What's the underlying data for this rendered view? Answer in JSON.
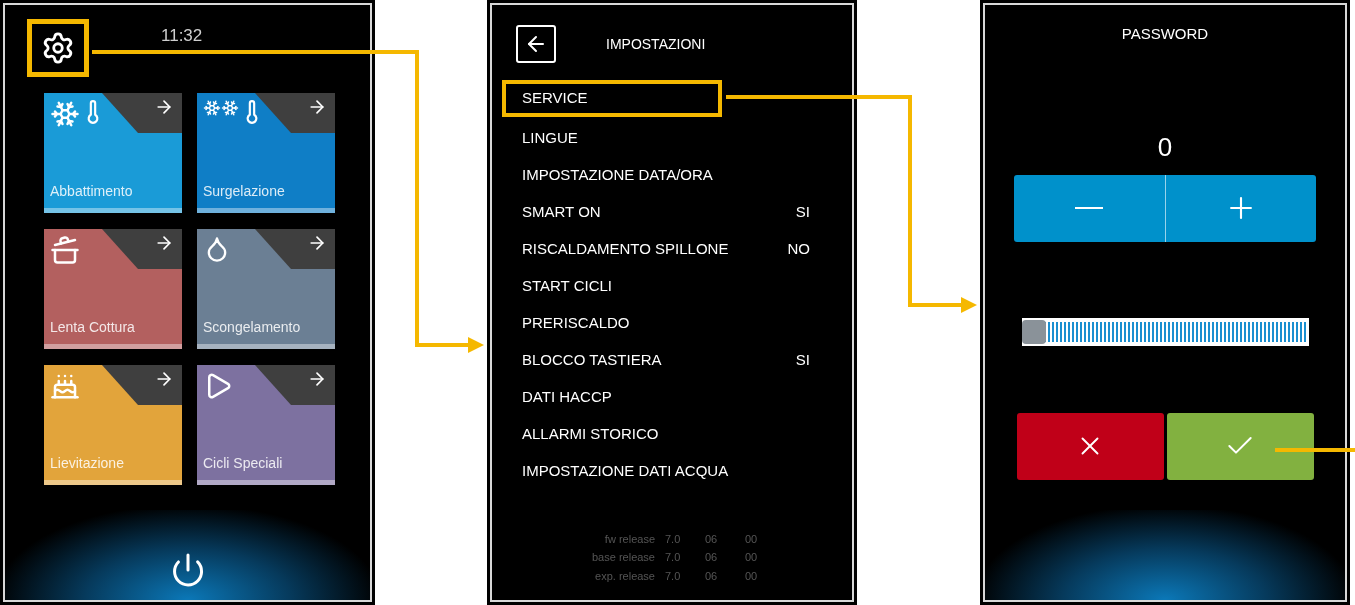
{
  "home": {
    "settings_highlighted": true,
    "time": "11:32",
    "tiles": [
      {
        "label": "Abbattimento",
        "kind": "blast",
        "color": "#1a9bd7"
      },
      {
        "label": "Surgelazione",
        "kind": "freeze",
        "color": "#0f7ec6"
      },
      {
        "label": "Lenta Cottura",
        "kind": "cook",
        "color": "#b3605f"
      },
      {
        "label": "Scongelamento",
        "kind": "thaw",
        "color": "#6b7f94"
      },
      {
        "label": "Lievitazione",
        "kind": "proof",
        "color": "#e2a43b"
      },
      {
        "label": "Cicli Speciali",
        "kind": "special",
        "color": "#7d71a0"
      }
    ]
  },
  "settings": {
    "title": "IMPOSTAZIONI",
    "items": [
      {
        "label": "SERVICE",
        "highlighted": true
      },
      {
        "label": "LINGUE",
        "highlighted": false
      },
      {
        "label": "IMPOSTAZIONE DATA/ORA",
        "highlighted": false
      },
      {
        "label": "SMART ON",
        "value": "SI",
        "highlighted": false
      },
      {
        "label": "RISCALDAMENTO SPILLONE",
        "value": "NO",
        "highlighted": false
      },
      {
        "label": "START CICLI",
        "highlighted": false
      },
      {
        "label": "PRERISCALDO",
        "highlighted": false
      },
      {
        "label": "BLOCCO TASTIERA",
        "value": "SI",
        "highlighted": false
      },
      {
        "label": "DATI HACCP",
        "highlighted": false
      },
      {
        "label": "ALLARMI STORICO",
        "highlighted": false
      },
      {
        "label": "IMPOSTAZIONE DATI ACQUA",
        "highlighted": false
      }
    ],
    "release_info": [
      {
        "label": "fw release",
        "values": [
          "7.0",
          "06",
          "00"
        ]
      },
      {
        "label": "base release",
        "values": [
          "7.0",
          "06",
          "00"
        ]
      },
      {
        "label": "exp. release",
        "values": [
          "7.0",
          "06",
          "00"
        ]
      }
    ]
  },
  "password": {
    "title": "PASSWORD",
    "value": "0",
    "slider": {
      "level": 0
    }
  }
}
